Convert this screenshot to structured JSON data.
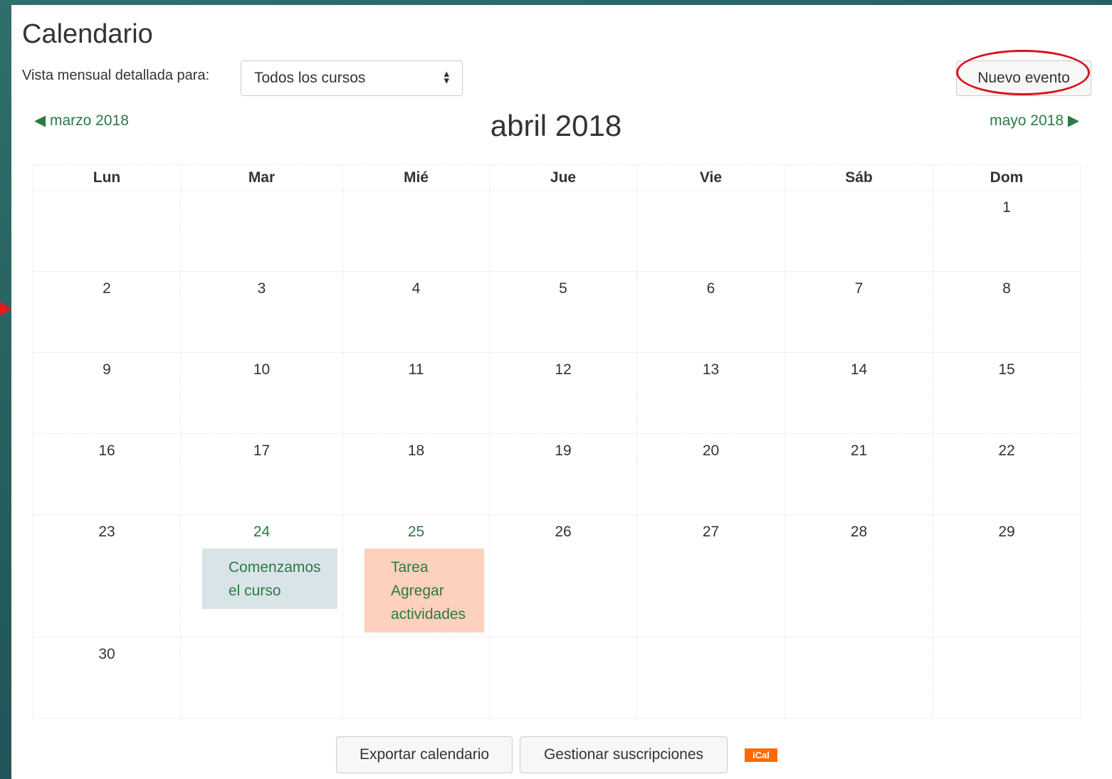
{
  "page": {
    "title": "Calendario"
  },
  "filter": {
    "label": "Vista mensual detallada para:",
    "selected": "Todos los cursos"
  },
  "actions": {
    "new_event": "Nuevo evento",
    "export": "Exportar calendario",
    "subscriptions": "Gestionar suscripciones",
    "ical": "iCal"
  },
  "nav": {
    "prev": "◀ marzo 2018",
    "next": "mayo 2018 ▶"
  },
  "calendar": {
    "month": "abril 2018",
    "weekdays": [
      "Lun",
      "Mar",
      "Mié",
      "Jue",
      "Vie",
      "Sáb",
      "Dom"
    ],
    "weeks": [
      [
        "",
        "",
        "",
        "",
        "",
        "",
        "1"
      ],
      [
        "2",
        "3",
        "4",
        "5",
        "6",
        "7",
        "8"
      ],
      [
        "9",
        "10",
        "11",
        "12",
        "13",
        "14",
        "15"
      ],
      [
        "16",
        "17",
        "18",
        "19",
        "20",
        "21",
        "22"
      ],
      [
        "23",
        "24",
        "25",
        "26",
        "27",
        "28",
        "29"
      ],
      [
        "30",
        "",
        "",
        "",
        "",
        "",
        ""
      ]
    ],
    "events": [
      {
        "day": "24",
        "text": "Comenzamos el curso",
        "kind": "course",
        "color": "#d9e4e8"
      },
      {
        "day": "25",
        "text": "Tarea Agregar actividades",
        "kind": "user",
        "color": "#fdd1bd"
      }
    ]
  },
  "colors": {
    "link": "#2b7a44",
    "highlight": "#d9131d",
    "ical": "#ff6a00"
  }
}
